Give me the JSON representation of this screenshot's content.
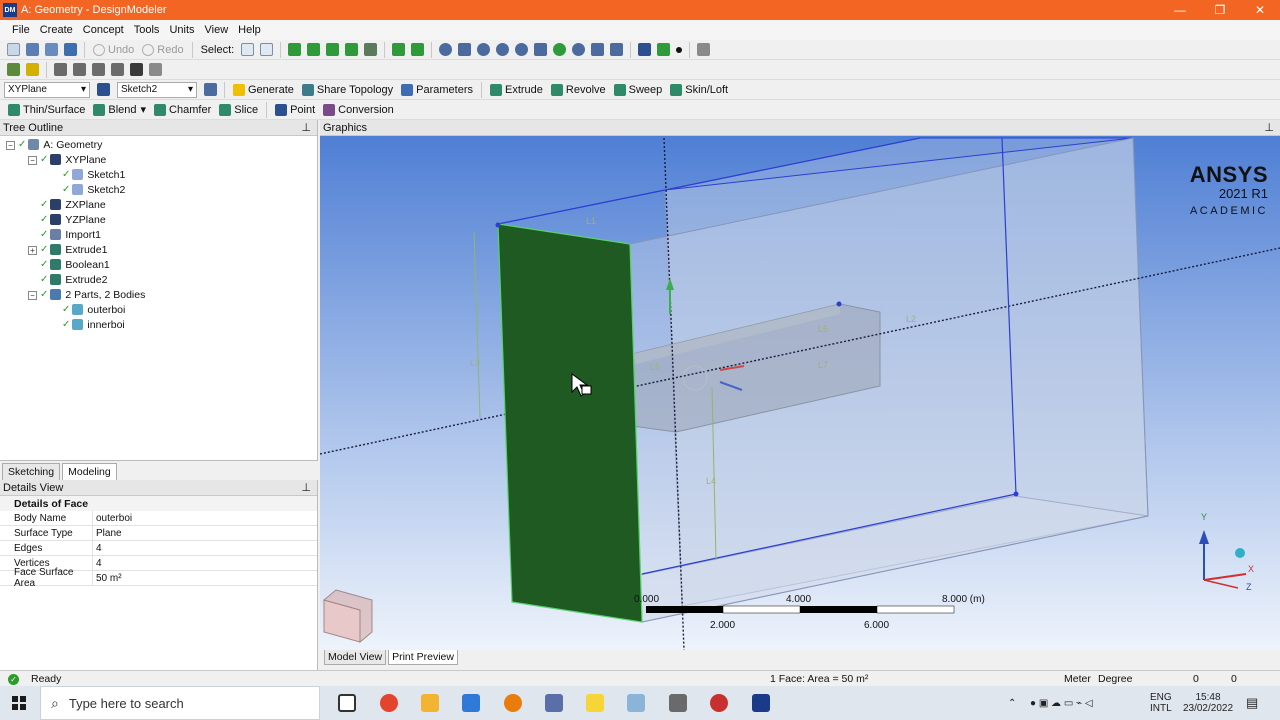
{
  "window": {
    "title": "A: Geometry - DesignModeler",
    "app_badge": "DM",
    "minimize": "—",
    "maximize": "❐",
    "close": "✕"
  },
  "menu": [
    "File",
    "Create",
    "Concept",
    "Tools",
    "Units",
    "View",
    "Help"
  ],
  "toolbar1": {
    "undo": "Undo",
    "redo": "Redo",
    "select": "Select:"
  },
  "toolbar3": {
    "plane": "XYPlane",
    "sketch": "Sketch2",
    "generate": "Generate",
    "share_topology": "Share Topology",
    "parameters": "Parameters",
    "extrude": "Extrude",
    "revolve": "Revolve",
    "sweep": "Sweep",
    "skin_loft": "Skin/Loft"
  },
  "toolbar4": {
    "thin_surface": "Thin/Surface",
    "blend": "Blend",
    "chamfer": "Chamfer",
    "slice": "Slice",
    "point": "Point",
    "conversion": "Conversion"
  },
  "tree": {
    "title": "Tree Outline",
    "pin": "⊥",
    "items": [
      {
        "label": "A: Geometry"
      },
      {
        "label": "XYPlane"
      },
      {
        "label": "Sketch1"
      },
      {
        "label": "Sketch2"
      },
      {
        "label": "ZXPlane"
      },
      {
        "label": "YZPlane"
      },
      {
        "label": "Import1"
      },
      {
        "label": "Extrude1"
      },
      {
        "label": "Boolean1"
      },
      {
        "label": "Extrude2"
      },
      {
        "label": "2 Parts, 2 Bodies"
      },
      {
        "label": "outerboi"
      },
      {
        "label": "innerboi"
      }
    ]
  },
  "mode_tabs": {
    "sketching": "Sketching",
    "modeling": "Modeling"
  },
  "details": {
    "title": "Details View",
    "group": "Details of Face",
    "rows": [
      {
        "key": "Body Name",
        "value": "outerboi"
      },
      {
        "key": "Surface Type",
        "value": "Plane"
      },
      {
        "key": "Edges",
        "value": "4"
      },
      {
        "key": "Vertices",
        "value": "4"
      },
      {
        "key": "Face Surface Area",
        "value": "50 m²"
      }
    ]
  },
  "graphics": {
    "title": "Graphics",
    "logo": {
      "name": "ANSYS",
      "version": "2021 R1",
      "edition": "ACADEMIC"
    },
    "scale": {
      "t0": "0.000",
      "t2": "2.000",
      "t4": "4.000",
      "t6": "6.000",
      "t8": "8.000 (m)"
    },
    "dims": {
      "L1": "L1",
      "L2": "L2",
      "L3": "L3",
      "L4": "L4",
      "L5": "L5",
      "L6": "L6",
      "L7": "L7"
    },
    "triad": {
      "x": "X",
      "y": "Y",
      "z": "Z"
    }
  },
  "bottom_tabs": {
    "model_view": "Model View",
    "print_preview": "Print Preview"
  },
  "status": {
    "ready": "Ready",
    "selection": "1 Face: Area = 50 m²",
    "units_length": "Meter",
    "units_angle": "Degree",
    "val1": "0",
    "val2": "0"
  },
  "taskbar": {
    "search_placeholder": "Type here to search",
    "lang1": "ENG",
    "lang2": "INTL",
    "time": "15:48",
    "date": "23/02/2022"
  },
  "colors": {
    "titlebar": "#f26522",
    "selected_face": "#1f5a22",
    "viewport_top": "#4f7fd4",
    "viewport_bottom": "#eef3fb"
  }
}
